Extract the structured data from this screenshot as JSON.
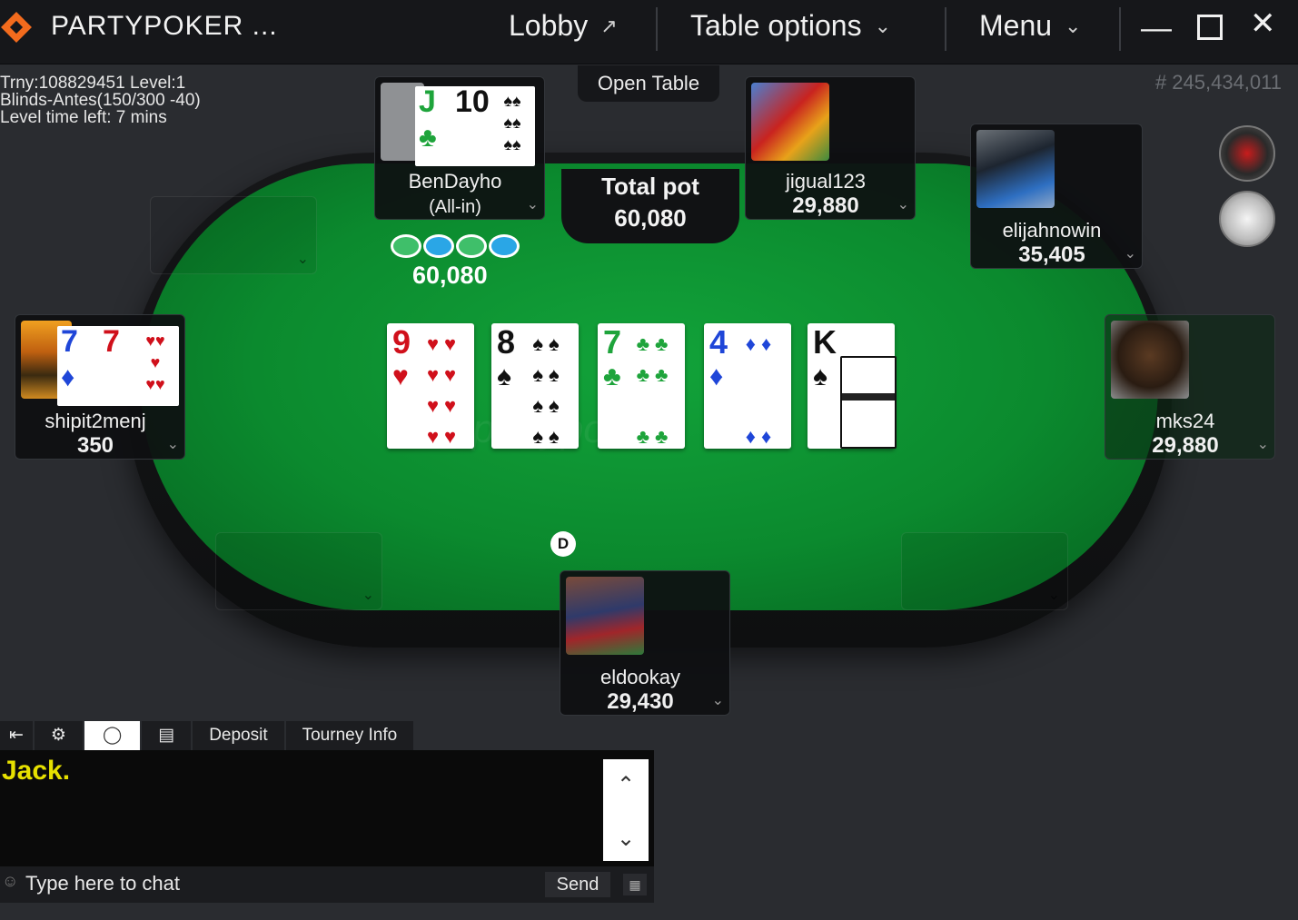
{
  "titlebar": {
    "title": "PARTYPOKER ...",
    "lobby": "Lobby",
    "lobby_icon": "external-arrow-icon",
    "table_options": "Table options",
    "menu": "Menu"
  },
  "info": {
    "line1": "Trny:108829451 Level:1",
    "line2": "Blinds-Antes(150/300 -40)",
    "line3": "Level time left: 7 mins"
  },
  "hand_number": "# 245,434,011",
  "open_table": "Open Table",
  "pot": {
    "label": "Total pot",
    "value": "60,080"
  },
  "bet_chips_amount": "60,080",
  "dealer_label": "D",
  "players": [
    {
      "name": "BenDayho",
      "stack": "(All-in)",
      "cards": [
        {
          "rank": "J",
          "suit": "♣",
          "color": "green"
        },
        {
          "rank": "10",
          "suit": "♠",
          "color": "black"
        }
      ]
    },
    {
      "name": "jigual123",
      "stack": "29,880"
    },
    {
      "name": "elijahnowin",
      "stack": "35,405"
    },
    {
      "name": "mks24",
      "stack": "29,880"
    },
    {
      "name": "eldookay",
      "stack": "29,430"
    },
    {
      "name": "shipit2menj",
      "stack": "350",
      "cards": [
        {
          "rank": "7",
          "suit": "♦",
          "color": "blue"
        },
        {
          "rank": "7",
          "suit": "♥",
          "color": "red"
        }
      ]
    }
  ],
  "board": [
    {
      "rank": "9",
      "suit": "♥",
      "color": "red"
    },
    {
      "rank": "8",
      "suit": "♠",
      "color": "black"
    },
    {
      "rank": "7",
      "suit": "♣",
      "color": "green"
    },
    {
      "rank": "4",
      "suit": "♦",
      "color": "blue"
    },
    {
      "rank": "K",
      "suit": "♠",
      "color": "black"
    }
  ],
  "chat": {
    "tabs": [
      "Deposit",
      "Tourney Info"
    ],
    "message": "Jack.",
    "placeholder": "Type here to chat",
    "send": "Send"
  },
  "colors": {
    "felt": "#0b8a2e",
    "brand": "#f26b1d",
    "chat_highlight": "#e6e000"
  }
}
